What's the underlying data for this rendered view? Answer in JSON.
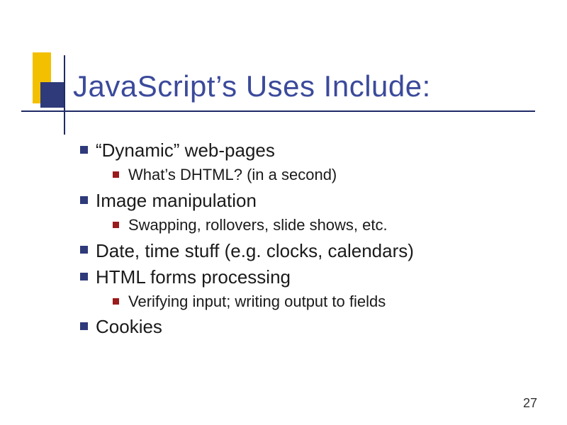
{
  "title": "JavaScript’s Uses Include:",
  "bullets": {
    "b0": "“Dynamic” web-pages",
    "b0_0": "What’s DHTML? (in a second)",
    "b1": "Image manipulation",
    "b1_0": "Swapping, rollovers, slide shows, etc.",
    "b2": "Date, time stuff (e.g. clocks, calendars)",
    "b3": "HTML forms processing",
    "b3_0": "Verifying input; writing output to fields",
    "b4": "Cookies"
  },
  "page_number": "27",
  "colors": {
    "title": "#3b4a9b",
    "bullet_primary": "#2e3a7a",
    "bullet_secondary": "#9a1b1b",
    "accent_yellow": "#f3c000"
  }
}
